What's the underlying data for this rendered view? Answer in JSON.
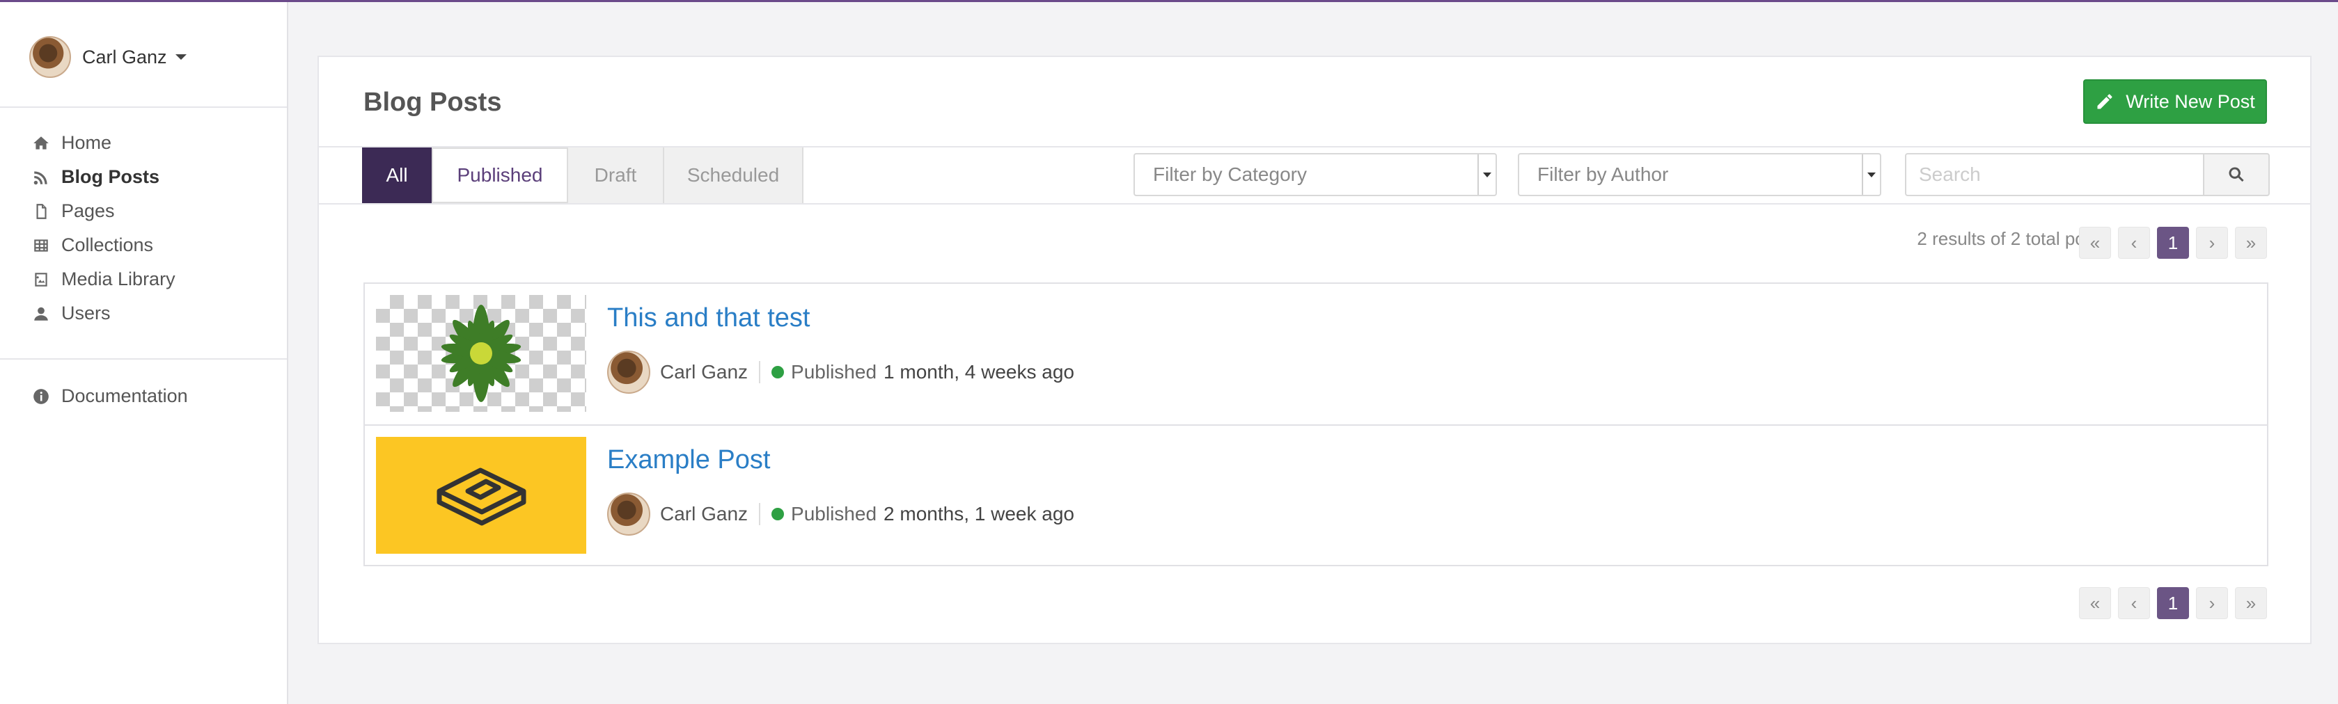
{
  "colors": {
    "accent": "#3c2a55",
    "primary_green": "#2ea043",
    "link": "#2a7ec6",
    "page_current": "#6b5585"
  },
  "user": {
    "name": "Carl Ganz"
  },
  "sidebar": {
    "items": [
      {
        "label": "Home",
        "icon": "home-icon"
      },
      {
        "label": "Blog Posts",
        "icon": "rss-icon"
      },
      {
        "label": "Pages",
        "icon": "file-icon"
      },
      {
        "label": "Collections",
        "icon": "table-icon"
      },
      {
        "label": "Media Library",
        "icon": "image-icon"
      },
      {
        "label": "Users",
        "icon": "user-icon"
      }
    ],
    "docs": {
      "label": "Documentation",
      "icon": "info-icon"
    }
  },
  "main": {
    "title": "Blog Posts",
    "write_button": "Write New Post",
    "tabs": [
      "All",
      "Published",
      "Draft",
      "Scheduled"
    ],
    "filters": {
      "category": "Filter by Category",
      "author": "Filter by Author",
      "search_placeholder": "Search"
    },
    "results_text": "2 results of 2 total posts",
    "pagination": {
      "first": "«",
      "prev": "‹",
      "current": "1",
      "next": "›",
      "last": "»"
    },
    "posts": [
      {
        "title": "This and that test",
        "author": "Carl Ganz",
        "status": "Published",
        "ago": "1 month, 4 weeks ago"
      },
      {
        "title": "Example Post",
        "author": "Carl Ganz",
        "status": "Published",
        "ago": "2 months, 1 week ago"
      }
    ]
  }
}
